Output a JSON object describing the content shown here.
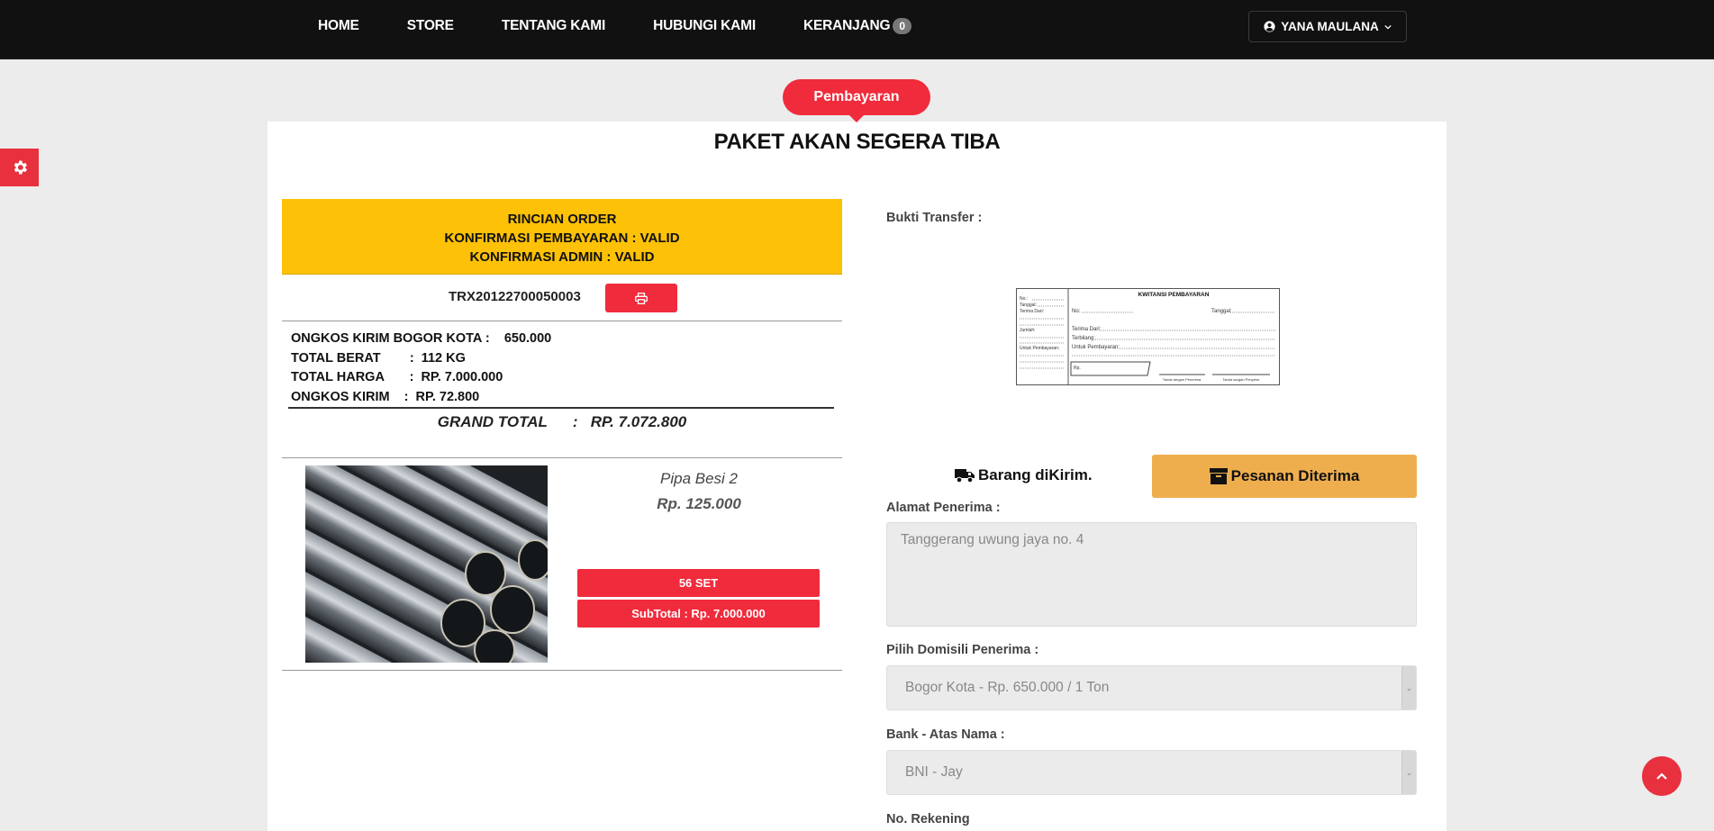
{
  "nav": {
    "items": [
      "HOME",
      "STORE",
      "TENTANG KAMI",
      "HUBUNGI KAMI",
      "KERANJANG"
    ],
    "cart_count": "0",
    "user_name": "YANA MAULANA"
  },
  "page": {
    "pill_label": "Pembayaran",
    "title": "PAKET AKAN SEGERA TIBA"
  },
  "order": {
    "heading": "RINCIAN ORDER",
    "payment_confirmation": "KONFIRMASI PEMBAYARAN : VALID",
    "admin_confirmation": "KONFIRMASI ADMIN : VALID",
    "trx_code": "TRX20122700050003",
    "shipping_city_line": "ONGKOS KIRIM BOGOR KOTA :    650.000",
    "total_weight_line": "TOTAL BERAT        :  112 KG",
    "total_price_line": "TOTAL HARGA       :  RP. 7.000.000",
    "shipping_cost_line": "ONGKOS KIRIM    :  RP. 72.800",
    "grand_total_line": "GRAND TOTAL      :   RP. 7.072.800"
  },
  "product": {
    "name": "Pipa Besi 2",
    "price": "Rp. 125.000",
    "quantity": "56 SET",
    "subtotal": "SubTotal : Rp. 7.000.000"
  },
  "right": {
    "transfer_label": "Bukti Transfer :",
    "receipt_image": {
      "title": "KWITANSI PEMBAYARAN",
      "no": "No:",
      "tanggal": "Tanggal:",
      "terima_dari": "Terima Dari:",
      "terbilang": "Terbilang:",
      "untuk": "Untuk Pembayaran:",
      "rp": "Rp.",
      "ttd_penerima": "Tanda tangan Penerima",
      "ttd_penyetor": "Tanda tangan Penyetor",
      "side_no": "No.:",
      "side_tanggal": "Tanggal:",
      "side_terima": "Terima Dari:",
      "side_jumlah": "Jumlah:",
      "side_untuk": "Untuk Pembayaran:"
    },
    "sent_label": "Barang diKirim.",
    "received_label": "Pesanan Diterima",
    "address_label": "Alamat Penerima :",
    "address_value": "Tanggerang uwung jaya no. 4",
    "domicile_label": "Pilih Domisili Penerima :",
    "domicile_value": "Bogor Kota - Rp. 650.000 / 1 Ton",
    "bank_label": "Bank - Atas Nama :",
    "bank_value": "BNI - Jay",
    "account_label": "No. Rekening"
  },
  "colors": {
    "navbar": "#111111",
    "accent_red": "#f02b3c",
    "order_yellow": "#fdc107",
    "received_orange": "#efae4e"
  },
  "icons": [
    "gear-icon",
    "print-icon",
    "truck-icon",
    "archive-icon",
    "user-circle-icon",
    "chevron-down-icon",
    "chevron-up-icon"
  ]
}
